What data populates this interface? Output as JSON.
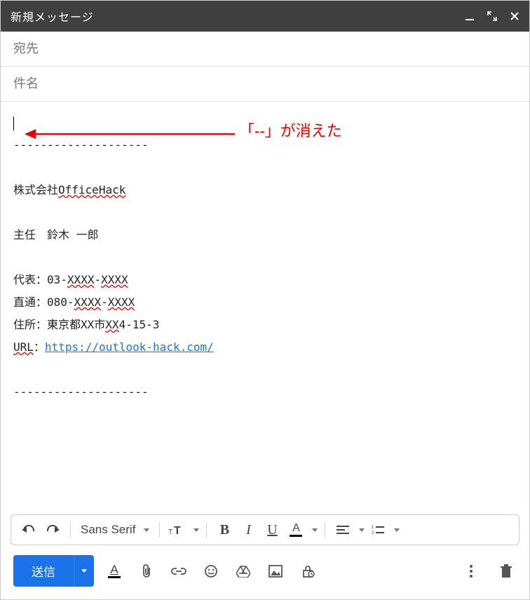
{
  "window": {
    "title": "新規メッセージ"
  },
  "fields": {
    "to_placeholder": "宛先",
    "to_value": "",
    "subject_placeholder": "件名",
    "subject_value": ""
  },
  "body": {
    "separator_top": "--------------------",
    "company": "株式会社OfficeHack",
    "role_name": "主任　鈴木 一郎",
    "phone_main_label": "代表：",
    "phone_main_value": "03-XXXX-XXXX",
    "phone_direct_label": "直通：",
    "phone_direct_value": "080-XXXX-XXXX",
    "address_label": "住所：",
    "address_value": "東京都XX市XX4-15-3",
    "url_label": "URL：",
    "url_value": "https://outlook-hack.com/",
    "separator_bottom": "--------------------"
  },
  "annotation": {
    "text": "「--」が消えた"
  },
  "toolbar": {
    "font": "Sans Serif"
  },
  "footer": {
    "send_label": "送信"
  },
  "colors": {
    "accent": "#1a73e8",
    "annotation": "#e60000",
    "titlebar": "#404040"
  }
}
